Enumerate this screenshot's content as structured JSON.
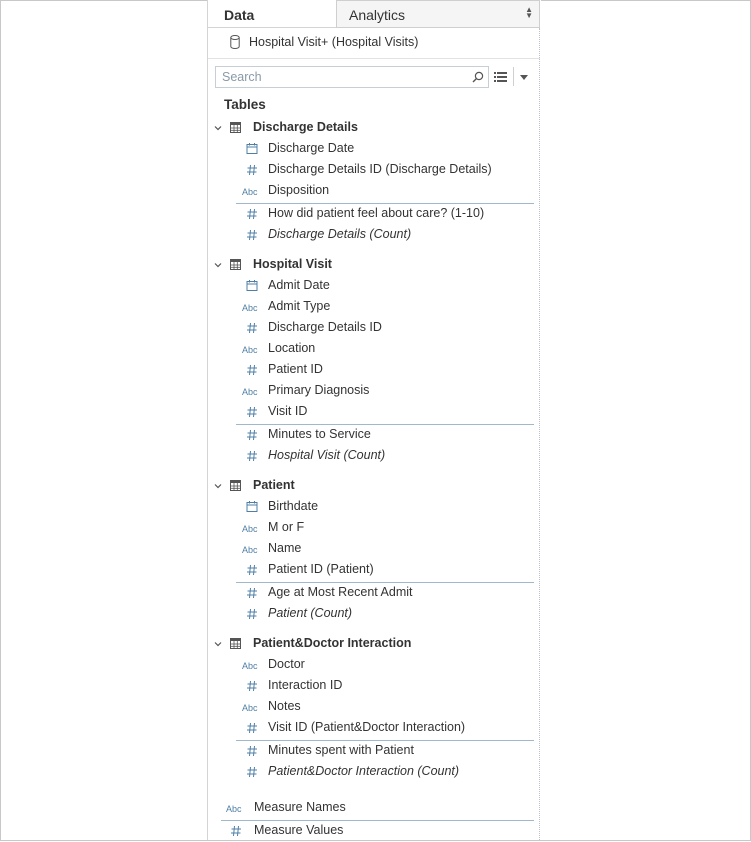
{
  "tabs": {
    "data_label": "Data",
    "analytics_label": "Analytics"
  },
  "datasource": {
    "label": "Hospital Visit+ (Hospital Visits)"
  },
  "search": {
    "placeholder": "Search"
  },
  "tables_heading": "Tables",
  "tables": [
    {
      "name": "Discharge Details",
      "fields": [
        {
          "label": "Discharge Date",
          "icon": "calendar-icon"
        },
        {
          "label": "Discharge Details ID (Discharge Details)",
          "icon": "number-icon"
        },
        {
          "label": "Disposition",
          "icon": "abc-icon"
        }
      ],
      "measures": [
        {
          "label": "How did patient feel about care? (1-10)",
          "icon": "number-icon"
        },
        {
          "label": "Discharge Details (Count)",
          "icon": "number-icon",
          "italic": true
        }
      ]
    },
    {
      "name": "Hospital Visit",
      "fields": [
        {
          "label": "Admit Date",
          "icon": "calendar-icon"
        },
        {
          "label": "Admit Type",
          "icon": "abc-icon"
        },
        {
          "label": "Discharge Details ID",
          "icon": "number-icon"
        },
        {
          "label": "Location",
          "icon": "abc-icon"
        },
        {
          "label": "Patient ID",
          "icon": "number-icon"
        },
        {
          "label": "Primary Diagnosis",
          "icon": "abc-icon"
        },
        {
          "label": "Visit ID",
          "icon": "number-icon"
        }
      ],
      "measures": [
        {
          "label": "Minutes to Service",
          "icon": "number-icon"
        },
        {
          "label": "Hospital Visit (Count)",
          "icon": "number-icon",
          "italic": true
        }
      ]
    },
    {
      "name": "Patient",
      "fields": [
        {
          "label": "Birthdate",
          "icon": "calendar-icon"
        },
        {
          "label": "M or F",
          "icon": "abc-icon"
        },
        {
          "label": "Name",
          "icon": "abc-icon"
        },
        {
          "label": "Patient ID (Patient)",
          "icon": "number-icon"
        }
      ],
      "measures": [
        {
          "label": "Age at Most Recent Admit",
          "icon": "number-icon"
        },
        {
          "label": "Patient (Count)",
          "icon": "number-icon",
          "italic": true
        }
      ]
    },
    {
      "name": "Patient&Doctor Interaction",
      "fields": [
        {
          "label": "Doctor",
          "icon": "abc-icon"
        },
        {
          "label": "Interaction ID",
          "icon": "number-icon"
        },
        {
          "label": "Notes",
          "icon": "abc-icon"
        },
        {
          "label": "Visit ID (Patient&Doctor Interaction)",
          "icon": "number-icon"
        }
      ],
      "measures": [
        {
          "label": "Minutes spent with Patient",
          "icon": "number-icon"
        },
        {
          "label": "Patient&Doctor Interaction (Count)",
          "icon": "number-icon",
          "italic": true
        }
      ]
    }
  ],
  "measure_names": {
    "label": "Measure Names",
    "icon": "abc-icon"
  },
  "measure_values": {
    "label": "Measure Values",
    "icon": "number-icon"
  },
  "colors": {
    "accent": "#4f7fa6",
    "text": "#333333",
    "divider": "#9fb8cc"
  }
}
